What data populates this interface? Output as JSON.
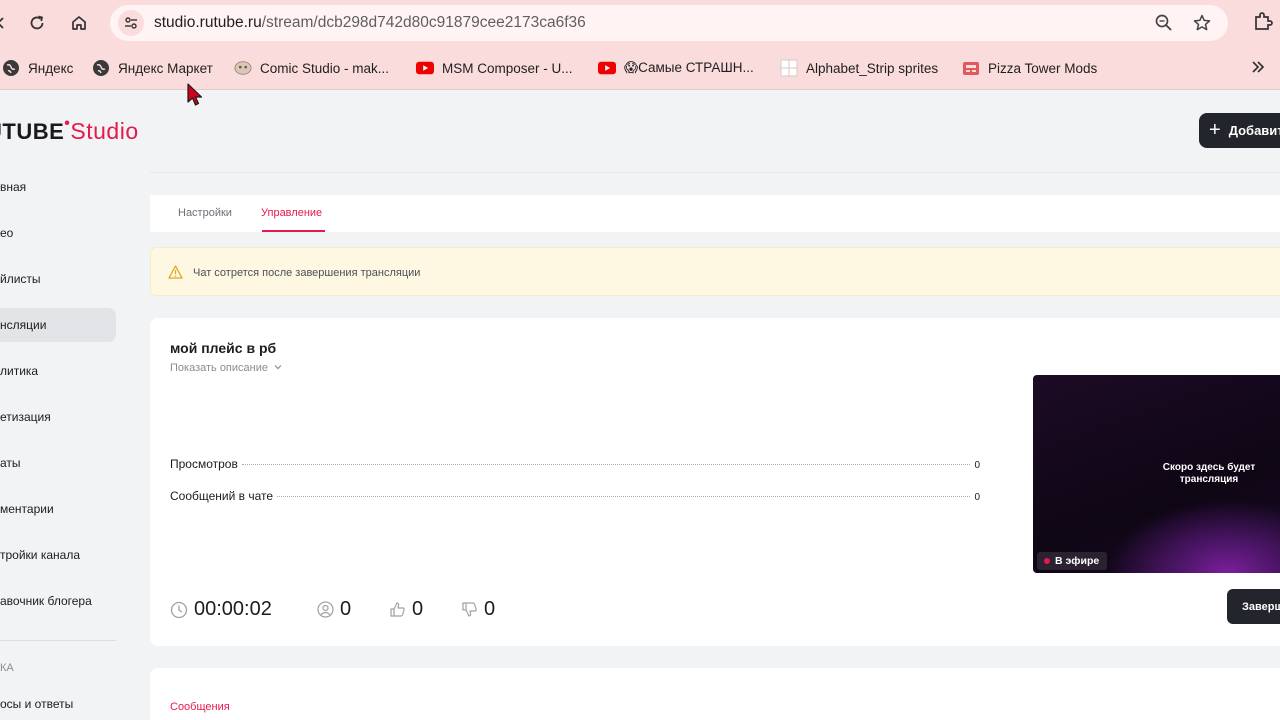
{
  "browser": {
    "url_host": "studio.rutube.ru",
    "url_path": "/stream/dcb298d742d80c91879cee2173ca6f36",
    "bookmarks": [
      {
        "label": "Яндекс",
        "icon": "globe-icon"
      },
      {
        "label": "Яндекс Маркет",
        "icon": "globe-icon"
      },
      {
        "label": "Comic Studio - mak...",
        "icon": "comic-studio-icon"
      },
      {
        "label": "MSM Composer - U...",
        "icon": "youtube-icon"
      },
      {
        "label": "😱Самые СТРАШН...",
        "icon": "youtube-icon"
      },
      {
        "label": "Alphabet_Strip sprites",
        "icon": "grid-icon"
      },
      {
        "label": "Pizza Tower Mods",
        "icon": "gamebanana-icon"
      }
    ]
  },
  "header": {
    "logo_main": "UTUBE",
    "logo_studio": "Studio",
    "add_button": "Добавить"
  },
  "sidebar": {
    "items": [
      {
        "label": "вная"
      },
      {
        "label": "ео"
      },
      {
        "label": "йлисты"
      },
      {
        "label": "нсляции"
      },
      {
        "label": "литика"
      },
      {
        "label": "етизация"
      },
      {
        "label": "аты"
      },
      {
        "label": "ментарии"
      },
      {
        "label": "тройки канала"
      },
      {
        "label": "авочник блогера"
      }
    ],
    "section_label": "КА",
    "section_item": "осы и ответы"
  },
  "tabs": [
    {
      "label": "Настройки"
    },
    {
      "label": "Управление"
    }
  ],
  "alert": {
    "text": "Чат сотрется после завершения трансляции"
  },
  "stream": {
    "title": "мой плейс в рб",
    "show_description": "Показать описание",
    "stats": [
      {
        "label": "Просмотров",
        "value": "0"
      },
      {
        "label": "Сообщений в чате",
        "value": "0"
      }
    ],
    "timer": "00:00:02",
    "viewers": "0",
    "likes": "0",
    "dislikes": "0",
    "preview_text": "Скоро здесь будет трансляция",
    "live_badge": "В эфире",
    "end_button": "Заверш"
  },
  "chat": {
    "label": "Сообщения"
  },
  "colors": {
    "accent": "#e5184f",
    "toolbar": "#fbdcdc",
    "dark_button": "#22252b"
  }
}
